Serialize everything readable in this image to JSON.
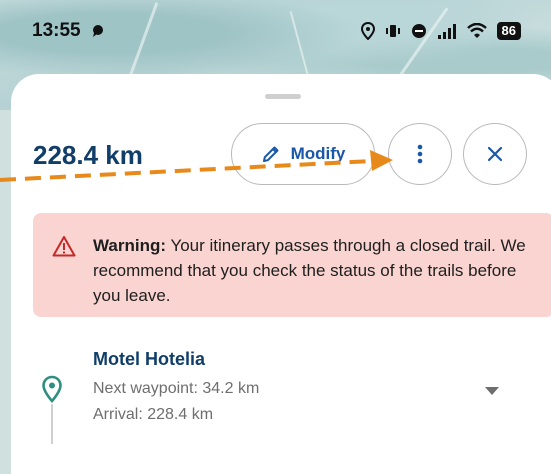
{
  "status_bar": {
    "time": "13:55",
    "battery": "86"
  },
  "route": {
    "distance": "228.4 km"
  },
  "actions": {
    "modify_label": "Modify"
  },
  "warning": {
    "prefix": "Warning:",
    "text": " Your itinerary passes through a closed trail. We recommend that you check the status of the trails before you leave."
  },
  "waypoint": {
    "name": "Motel Hotelia",
    "next": "Next waypoint: 34.2 km",
    "arrival": "Arrival: 228.4 km"
  },
  "colors": {
    "accent": "#1a57a8",
    "title": "#113e69",
    "warning_bg": "#f9d4d1",
    "warning_icon": "#c62828",
    "annotation_arrow": "#e8891c",
    "pin": "#2e8f80"
  }
}
